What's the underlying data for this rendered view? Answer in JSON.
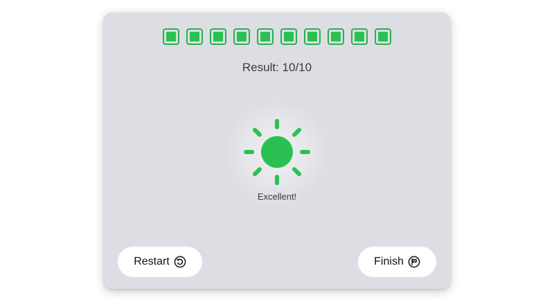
{
  "progress": {
    "total": 10,
    "completed": 10,
    "color": "#2bc152"
  },
  "result": {
    "text": "Result: 10/10"
  },
  "emblem": {
    "icon": "sun-icon",
    "color": "#2bc152",
    "caption": "Excellent!"
  },
  "buttons": {
    "restart_label": "Restart",
    "restart_icon": "restart-icon",
    "finish_label": "Finish",
    "finish_icon": "checkered-flag-icon"
  }
}
